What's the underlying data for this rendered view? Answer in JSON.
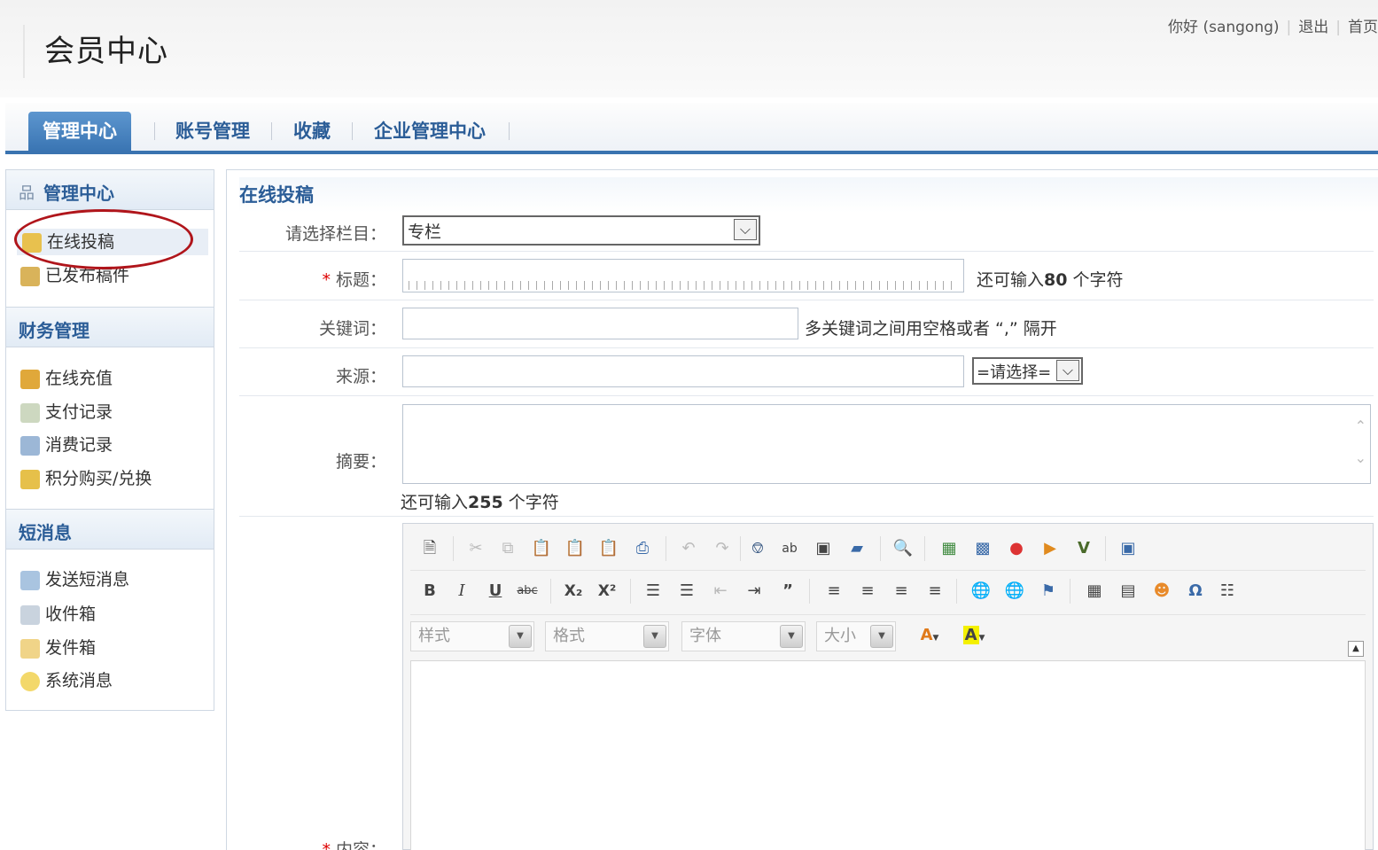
{
  "header": {
    "title": "会员中心",
    "greeting": "你好 (sangong)",
    "logout": "退出",
    "home": "首页"
  },
  "nav": {
    "tabs": [
      "管理中心",
      "账号管理",
      "收藏",
      "企业管理中心"
    ]
  },
  "sidebar": {
    "sections": [
      {
        "title": "管理中心",
        "items": [
          "在线投稿",
          "已发布稿件"
        ]
      },
      {
        "title": "财务管理",
        "items": [
          "在线充值",
          "支付记录",
          "消费记录",
          "积分购买/兑换"
        ]
      },
      {
        "title": "短消息",
        "items": [
          "发送短消息",
          "收件箱",
          "发件箱",
          "系统消息"
        ]
      }
    ]
  },
  "form": {
    "title": "在线投稿",
    "category_label": "请选择栏目：",
    "category_value": "专栏",
    "required_mark": "*",
    "title_label": "标题：",
    "title_hint_prefix": "还可输入",
    "title_hint_count": "80",
    "title_hint_suffix": " 个字符",
    "keywords_label": "关键词：",
    "keywords_hint": "多关键词之间用空格或者 “,” 隔开",
    "source_label": "来源：",
    "source_select": "=请选择=",
    "summary_label": "摘要：",
    "summary_hint_prefix": "还可输入",
    "summary_hint_count": "255",
    "summary_hint_suffix": " 个字符",
    "content_label": "内容："
  },
  "editor": {
    "combo_style": "样式",
    "combo_format": "格式",
    "combo_font": "字体",
    "combo_size": "大小",
    "font_color_letter": "A",
    "bg_color_letter": "A",
    "bold": "B",
    "italic": "I",
    "underline": "U",
    "strike": "abc",
    "subscript": "X₂",
    "superscript": "X²"
  },
  "colors": {
    "brand": "#2b5d97",
    "nav_active": "#3a75b3",
    "highlight_circle": "#b0151b",
    "required": "#dd0000"
  }
}
